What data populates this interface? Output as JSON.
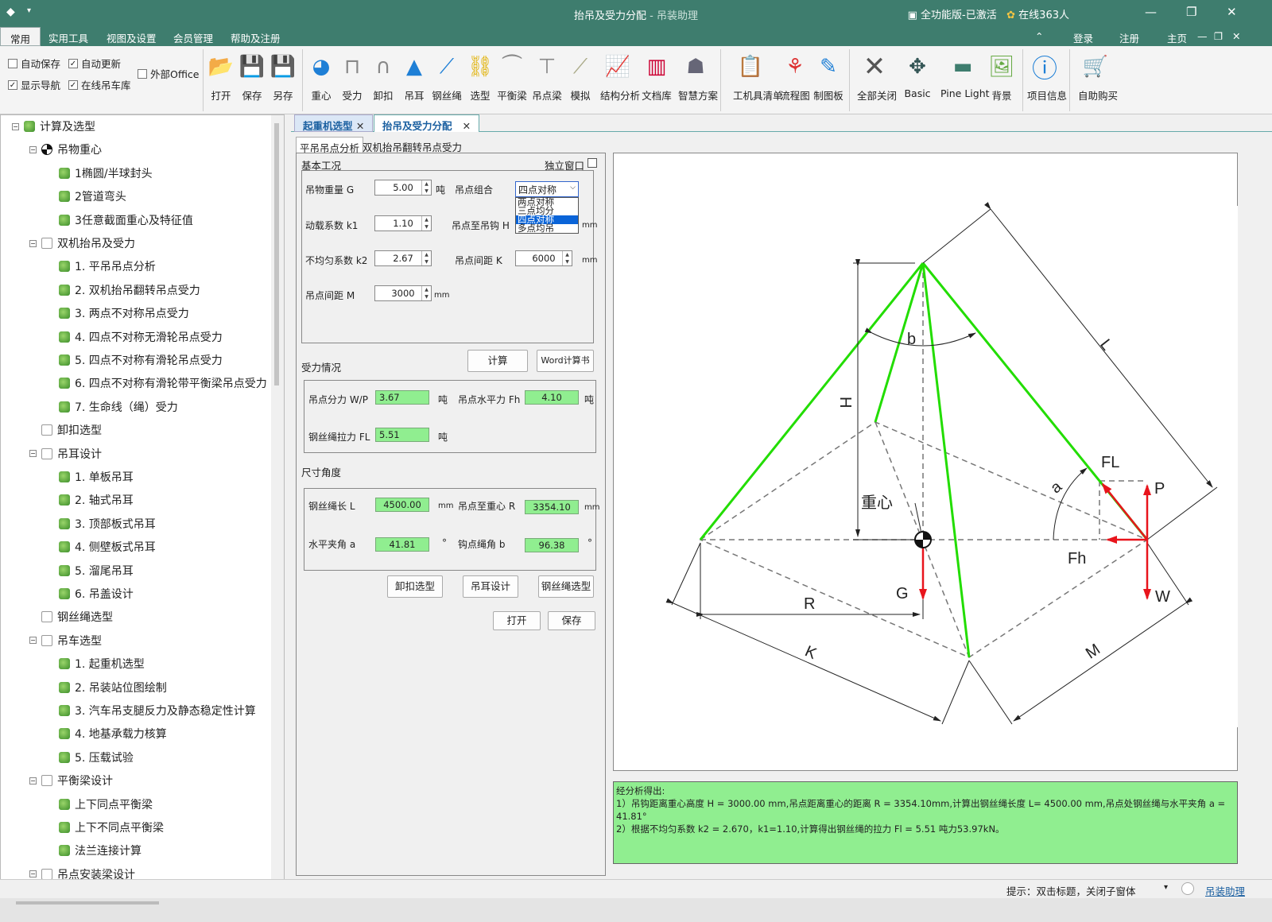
{
  "window": {
    "title": "抬吊及受力分配",
    "app_name": "吊装助理",
    "title_sep": " - ",
    "license": "全功能版-已激活",
    "online": "在线363人"
  },
  "menu": {
    "items": [
      "常用",
      "实用工具",
      "视图及设置",
      "会员管理",
      "帮助及注册"
    ],
    "login": "登录",
    "register": "注册",
    "home": "主页"
  },
  "ribbon": {
    "checks": [
      {
        "label": "自动保存",
        "checked": false
      },
      {
        "label": "自动更新",
        "checked": true
      },
      {
        "label": "外部Office",
        "checked": false
      },
      {
        "label": "显示导航",
        "checked": true
      },
      {
        "label": "在线吊车库",
        "checked": true
      }
    ],
    "buttons": [
      "打开",
      "保存",
      "另存",
      "重心",
      "受力",
      "卸扣",
      "吊耳",
      "钢丝绳",
      "选型",
      "平衡梁",
      "吊点梁",
      "模拟",
      "结构分析",
      "文档库",
      "智慧方案",
      "工机具清单",
      "流程图",
      "制图板",
      "全部关闭",
      "Basic",
      "Pine Light",
      "背景",
      "项目信息",
      "自助购买"
    ]
  },
  "tree": [
    {
      "label": "计算及选型",
      "level": 0,
      "icon": "leaf"
    },
    {
      "label": "吊物重心",
      "level": 1,
      "icon": "cg"
    },
    {
      "label": "1椭圆/半球封头",
      "level": 2,
      "icon": "leaf"
    },
    {
      "label": "2管道弯头",
      "level": 2,
      "icon": "leaf"
    },
    {
      "label": "3任意截面重心及特征值",
      "level": 2,
      "icon": "leaf"
    },
    {
      "label": "双机抬吊及受力",
      "level": 1,
      "icon": "beam"
    },
    {
      "label": "1. 平吊吊点分析",
      "level": 2,
      "icon": "leaf"
    },
    {
      "label": "2. 双机抬吊翻转吊点受力",
      "level": 2,
      "icon": "leaf"
    },
    {
      "label": "3. 两点不对称吊点受力",
      "level": 2,
      "icon": "leaf"
    },
    {
      "label": "4. 四点不对称无滑轮吊点受力",
      "level": 2,
      "icon": "leaf"
    },
    {
      "label": "5. 四点不对称有滑轮吊点受力",
      "level": 2,
      "icon": "leaf"
    },
    {
      "label": "6. 四点不对称有滑轮带平衡梁吊点受力",
      "level": 2,
      "icon": "leaf"
    },
    {
      "label": "7. 生命线（绳）受力",
      "level": 2,
      "icon": "leaf"
    },
    {
      "label": "卸扣选型",
      "level": 1,
      "icon": "shackle"
    },
    {
      "label": "吊耳设计",
      "level": 1,
      "icon": "lug"
    },
    {
      "label": "1. 单板吊耳",
      "level": 2,
      "icon": "leaf"
    },
    {
      "label": "2. 轴式吊耳",
      "level": 2,
      "icon": "leaf"
    },
    {
      "label": "3. 顶部板式吊耳",
      "level": 2,
      "icon": "leaf"
    },
    {
      "label": "4. 侧壁板式吊耳",
      "level": 2,
      "icon": "leaf"
    },
    {
      "label": "5. 溜尾吊耳",
      "level": 2,
      "icon": "leaf"
    },
    {
      "label": "6. 吊盖设计",
      "level": 2,
      "icon": "leaf"
    },
    {
      "label": "钢丝绳选型",
      "level": 1,
      "icon": "rope"
    },
    {
      "label": "吊车选型",
      "level": 1,
      "icon": "crane"
    },
    {
      "label": "1. 起重机选型",
      "level": 2,
      "icon": "leaf"
    },
    {
      "label": "2. 吊装站位图绘制",
      "level": 2,
      "icon": "leaf"
    },
    {
      "label": "3. 汽车吊支腿反力及静态稳定性计算",
      "level": 2,
      "icon": "leaf"
    },
    {
      "label": "4. 地基承载力核算",
      "level": 2,
      "icon": "leaf"
    },
    {
      "label": "5. 压载试验",
      "level": 2,
      "icon": "leaf"
    },
    {
      "label": "平衡梁设计",
      "level": 1,
      "icon": "beam"
    },
    {
      "label": "上下同点平衡梁",
      "level": 2,
      "icon": "leaf"
    },
    {
      "label": "上下不同点平衡梁",
      "level": 2,
      "icon": "leaf"
    },
    {
      "label": "法兰连接计算",
      "level": 2,
      "icon": "leaf"
    },
    {
      "label": "吊点安装梁设计",
      "level": 1,
      "icon": "beam"
    }
  ],
  "doc_tabs": [
    "起重机选型",
    "抬吊及受力分配"
  ],
  "sub_tabs": [
    "平吊吊点分析",
    "双机抬吊翻转吊点受力"
  ],
  "form": {
    "basic_title": "基本工况",
    "independent_window": "独立窗口",
    "weight_label": "吊物重量 G",
    "weight_value": "5.00",
    "weight_unit": "吨",
    "combo_label": "吊点组合",
    "combo_value": "四点对称",
    "combo_options": [
      "两点对称",
      "三点均分",
      "四点对称",
      "多点均吊"
    ],
    "k1_label": "动载系数 k1",
    "k1_value": "1.10",
    "hook_label": "吊点至吊钩 H",
    "hook_unit": "mm",
    "k2_label": "不均匀系数 k2",
    "k2_value": "2.67",
    "k_label": "吊点间距 K",
    "k_value": "6000",
    "k_unit": "mm",
    "m_label": "吊点间距 M",
    "m_value": "3000",
    "m_unit": "mm",
    "calc_button": "计算",
    "word_button": "Word计算书",
    "force_title": "受力情况",
    "wp_label": "吊点分力 W/P",
    "wp_value": "3.67",
    "wp_unit": "吨",
    "fh_label": "吊点水平力 Fh",
    "fh_value": "4.10",
    "fh_unit": "吨",
    "fl_label": "钢丝绳拉力 FL",
    "fl_value": "5.51",
    "fl_unit": "吨",
    "dim_title": "尺寸角度",
    "l_label": "钢丝绳长 L",
    "l_value": "4500.00",
    "l_unit": "mm",
    "r_label": "吊点至重心 R",
    "r_value": "3354.10",
    "r_unit": "mm",
    "a_label": "水平夹角 a",
    "a_value": "41.81",
    "a_unit": "°",
    "b_label": "钩点绳角 b",
    "b_value": "96.38",
    "b_unit": "°",
    "shackle_button": "卸扣选型",
    "lug_button": "吊耳设计",
    "rope_button": "钢丝绳选型",
    "open_button": "打开",
    "save_button": "保存"
  },
  "diagram_labels": {
    "b": "b",
    "L": "L",
    "H": "H",
    "FL": "FL",
    "P": "P",
    "a": "a",
    "cg": "重心",
    "Fh": "Fh",
    "G": "G",
    "W": "W",
    "R": "R",
    "K": "K",
    "M": "M"
  },
  "result": {
    "line1": "经分析得出:",
    "line2": "  1）吊钩距离重心高度 H = 3000.00 mm,吊点距离重心的距离 R = 3354.10mm,计算出钢丝绳长度  L= 4500.00 mm,吊点处钢丝绳与水平夹角 a = 41.81°",
    "line3": "  2）根据不均匀系数 k2 = 2.670，k1=1.10,计算得出钢丝绳的拉力 Fl = 5.51 吨力53.97kN。"
  },
  "status": {
    "hint": "提示：双击标题，关闭子窗体",
    "link": "吊装助理"
  },
  "colors": {
    "titlebar": "#3e7d6e",
    "green_field": "#90ee90",
    "rope": "#22dd00",
    "arrow": "#e8141c"
  }
}
